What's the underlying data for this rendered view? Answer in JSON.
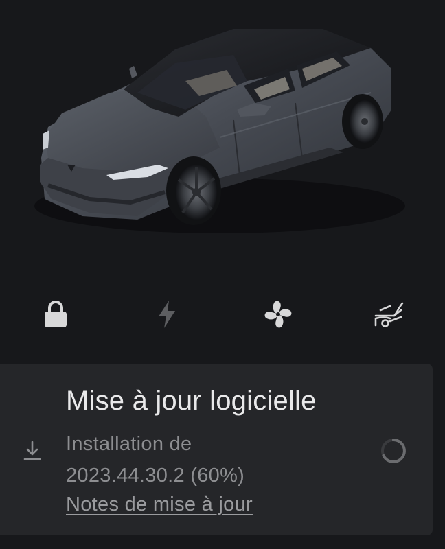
{
  "vehicle": {
    "image_name": "tesla-model-s-gray",
    "colors": {
      "body": "#4a4e56",
      "glass": "#1a1c20",
      "interior": "#c9c2b4",
      "background": "#17181b"
    }
  },
  "controls": [
    {
      "id": "lock",
      "icon": "lock-icon",
      "state": "locked"
    },
    {
      "id": "charge",
      "icon": "lightning-icon",
      "state": "inactive"
    },
    {
      "id": "climate",
      "icon": "fan-icon",
      "state": "active"
    },
    {
      "id": "frunk",
      "icon": "frunk-open-icon",
      "state": "active"
    }
  ],
  "software_update": {
    "title": "Mise à jour logicielle",
    "status_line1": "Installation de",
    "status_line2": "2023.44.30.2 (60%)",
    "release_notes_label": "Notes de mise à jour",
    "progress_percent": 60,
    "download_icon": "download-icon",
    "spinner_icon": "loading-spinner-icon"
  },
  "theme": {
    "card_background": "#252629",
    "text_primary": "#e9e9ea",
    "text_secondary": "#8d8e91",
    "icon_active": "#d8d8d9",
    "icon_inactive": "#5d5e61"
  }
}
